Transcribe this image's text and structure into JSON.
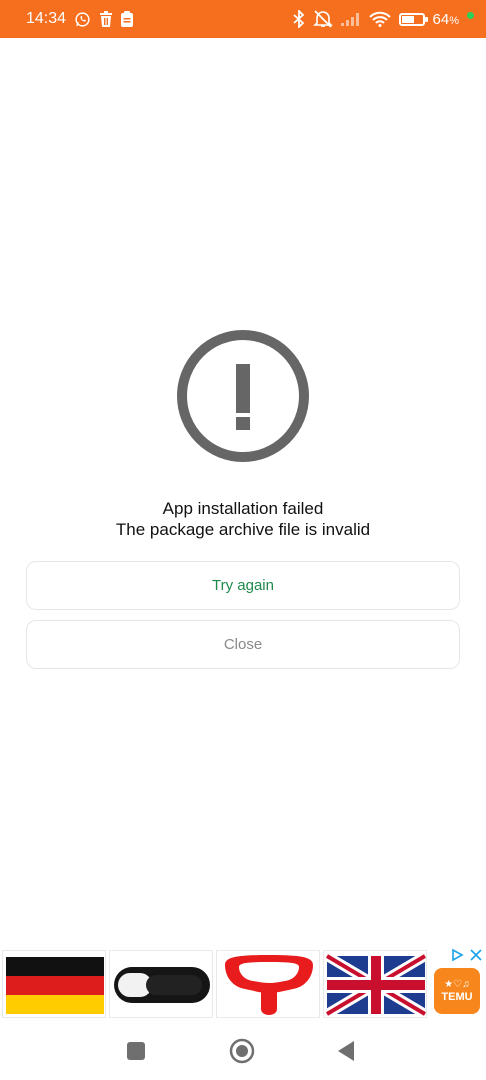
{
  "status_bar": {
    "time": "14:34",
    "battery_percent": "64",
    "battery_level": 0.64,
    "icons": [
      "whatsapp-icon",
      "trash-icon",
      "clipboard-icon",
      "bluetooth-icon",
      "mute-icon",
      "signal-icon",
      "wifi-icon",
      "battery-icon"
    ]
  },
  "dialog": {
    "icon": "alert-circle-icon",
    "title": "App installation failed",
    "subtitle": "The package archive file is invalid",
    "try_again_label": "Try again",
    "close_label": "Close",
    "accent_color": "#1f8a4c"
  },
  "ad": {
    "badge_text": "TEMU",
    "items": [
      "germany-flag",
      "webcam-cover",
      "vr-face-cushion",
      "uk-flag"
    ],
    "icons": [
      "adchoices-icon",
      "ad-close-icon"
    ]
  },
  "nav_bar": {
    "icons": [
      "recents-icon",
      "home-icon",
      "back-icon"
    ]
  },
  "colors": {
    "status_bar": "#f56f1f",
    "error_icon": "#666666",
    "close_text": "#8a8a8a"
  }
}
